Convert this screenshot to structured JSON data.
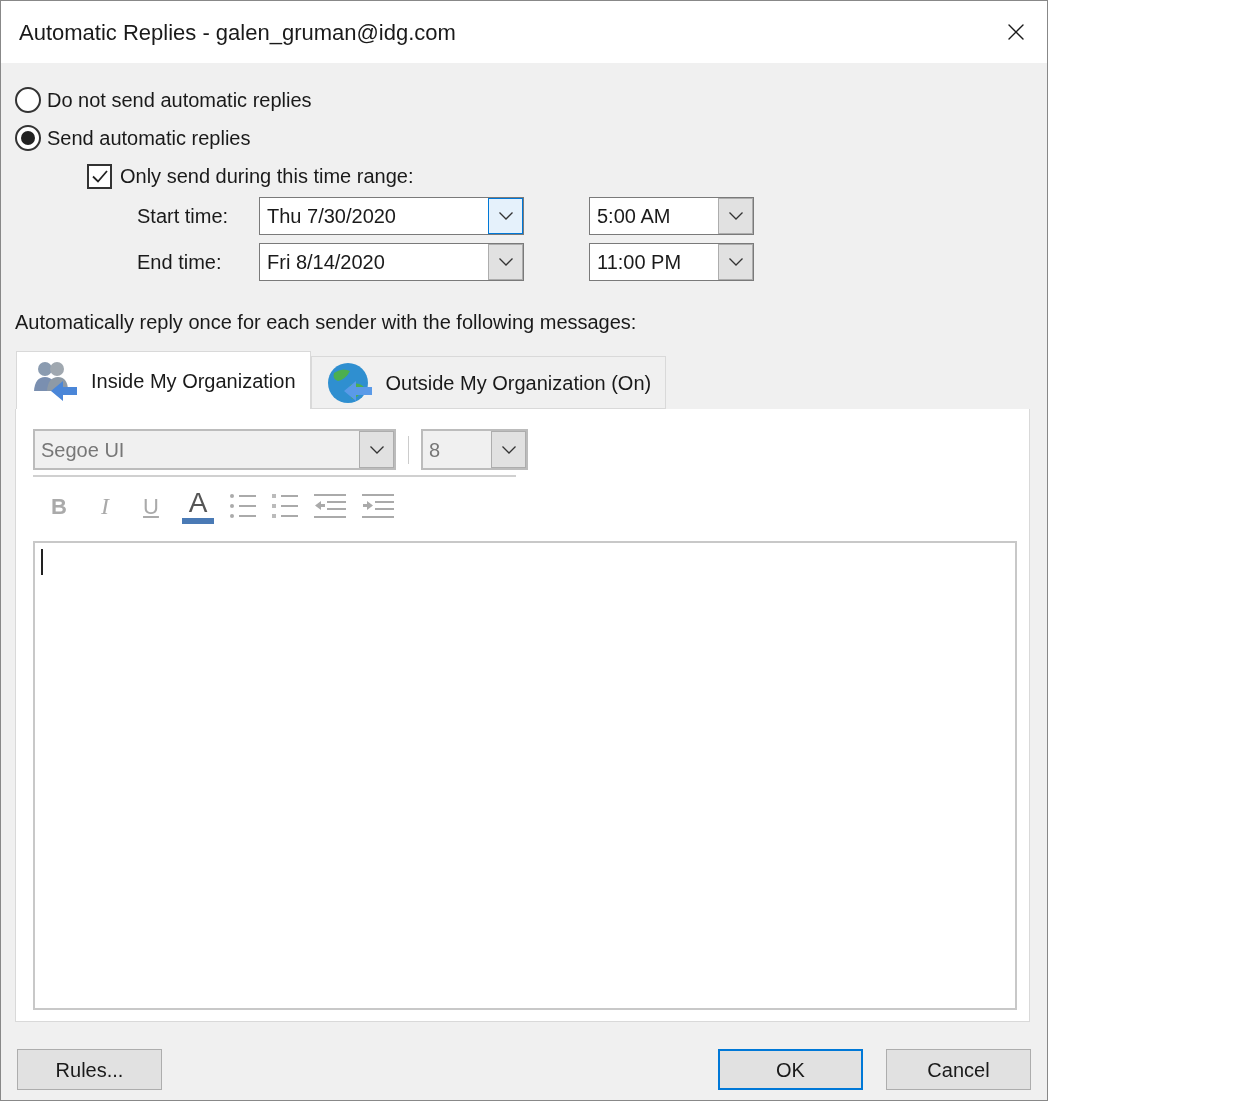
{
  "window": {
    "title": "Automatic Replies - galen_gruman@idg.com"
  },
  "reply_options": [
    {
      "label": "Do not send automatic replies",
      "selected": false
    },
    {
      "label": "Send automatic replies",
      "selected": true
    }
  ],
  "time_range": {
    "label": "Only send during this time range:",
    "checked": true
  },
  "times": [
    {
      "label": "Start time:",
      "date": "Thu 7/30/2020",
      "date_focused": true,
      "time": "5:00 AM"
    },
    {
      "label": "End time:",
      "date": "Fri 8/14/2020",
      "date_focused": false,
      "time": "11:00 PM"
    }
  ],
  "instruction": "Automatically reply once for each sender with the following messages:",
  "tabs": [
    {
      "label": "Inside My Organization",
      "selected": true,
      "kind": "people"
    },
    {
      "label": "Outside My Organization (On)",
      "selected": false,
      "kind": "globe"
    }
  ],
  "editor": {
    "font": "Segoe UI",
    "size": "8",
    "format_buttons": [
      {
        "kind": "bold",
        "label": "B"
      },
      {
        "kind": "italic",
        "label": "I"
      },
      {
        "kind": "underline",
        "label": "U"
      },
      {
        "kind": "color",
        "label": "A",
        "color": "#4a7ab5"
      },
      {
        "kind": "bullets"
      },
      {
        "kind": "numbering"
      },
      {
        "kind": "outdent"
      },
      {
        "kind": "indent"
      }
    ]
  },
  "buttons": [
    {
      "label": "Rules...",
      "default": false
    },
    {
      "label": "OK",
      "default": true
    },
    {
      "label": "Cancel",
      "default": false
    }
  ]
}
